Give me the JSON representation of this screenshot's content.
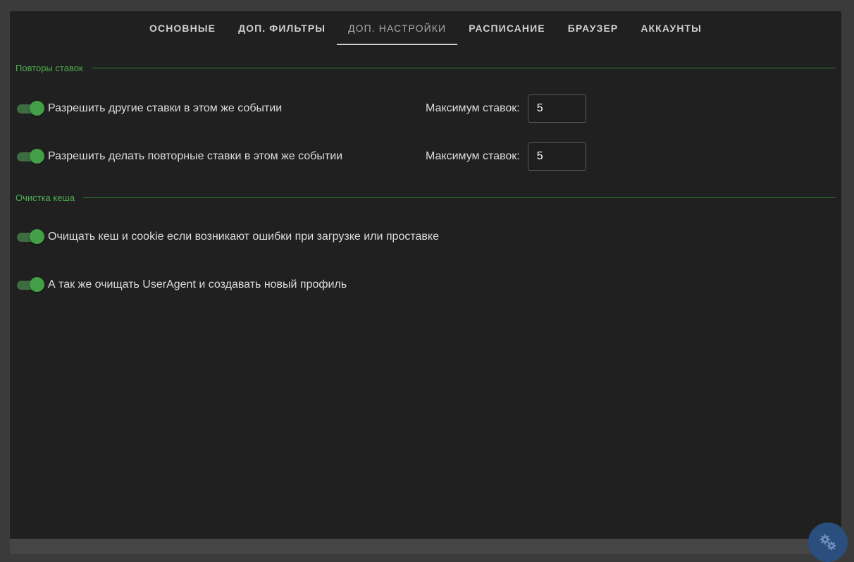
{
  "tabs": [
    {
      "label": "ОСНОВНЫЕ",
      "active": false
    },
    {
      "label": "ДОП. ФИЛЬТРЫ",
      "active": false
    },
    {
      "label": "ДОП. НАСТРОЙКИ",
      "active": true
    },
    {
      "label": "РАСПИСАНИЕ",
      "active": false
    },
    {
      "label": "БРАУЗЕР",
      "active": false
    },
    {
      "label": "АККАУНТЫ",
      "active": false
    }
  ],
  "sections": {
    "repeats": {
      "title": "Повторы ставок",
      "rows": [
        {
          "label": "Разрешить другие ставки в этом же событии",
          "enabled": true,
          "max_label": "Максимум ставок:",
          "max_value": "5"
        },
        {
          "label": "Разрешить делать повторные ставки в этом же событии",
          "enabled": true,
          "max_label": "Максимум ставок:",
          "max_value": "5"
        }
      ]
    },
    "cache": {
      "title": "Очистка кеша",
      "rows": [
        {
          "label": "Очищать кеш и cookie если возникают ошибки при загрузке или проставке",
          "enabled": true
        },
        {
          "label": "А так же очищать UserAgent и создавать новый профиль",
          "enabled": true
        }
      ]
    }
  },
  "fab": {
    "icon": "gears-icon"
  },
  "colors": {
    "accent": "#4caf50",
    "switch_on": "#43a047",
    "panel_bg": "#202020",
    "fab_bg": "#2a4f7e"
  }
}
